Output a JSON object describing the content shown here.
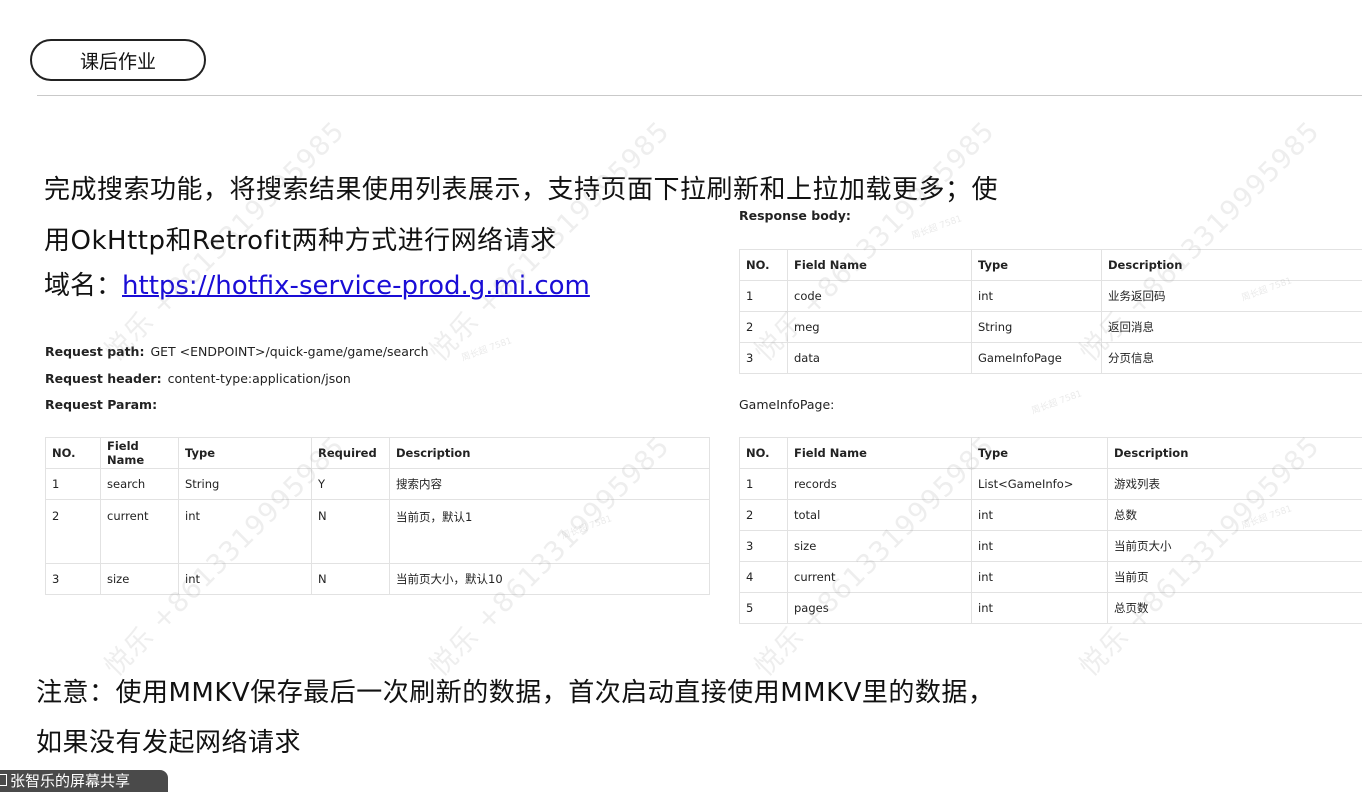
{
  "section_tag": "课后作业",
  "task": {
    "line1": "完成搜索功能，将搜索结果使用列表展示，支持页面下拉刷新和上拉加载更多；使",
    "line2": "用OkHttp和Retrofit两种方式进行网络请求",
    "domain_label": "域名：",
    "domain_url": "https://hotfix-service-prod.g.mi.com"
  },
  "request": {
    "path_label": "Request path:",
    "path_value": "GET <ENDPOINT>/quick-game/game/search",
    "header_label": "Request header:",
    "header_value": "content-type:application/json",
    "param_label": "Request Param:"
  },
  "request_params_table": {
    "headers": [
      "NO.",
      "Field Name",
      "Type",
      "Required",
      "Description"
    ],
    "rows": [
      [
        "1",
        "search",
        "String",
        "Y",
        "搜索内容"
      ],
      [
        "2",
        "current",
        "int",
        "N",
        "当前页，默认1"
      ],
      [
        "3",
        "size",
        "int",
        "N",
        "当前页大小，默认10"
      ]
    ]
  },
  "response_body": {
    "label": "Response body:",
    "headers": [
      "NO.",
      "Field Name",
      "Type",
      "Description"
    ],
    "rows": [
      [
        "1",
        "code",
        "int",
        "业务返回码"
      ],
      [
        "2",
        "meg",
        "String",
        "返回消息"
      ],
      [
        "3",
        "data",
        "GameInfoPage",
        "分页信息"
      ]
    ]
  },
  "game_info_page": {
    "label": "GameInfoPage:",
    "headers": [
      "NO.",
      "Field Name",
      "Type",
      "Description"
    ],
    "rows": [
      [
        "1",
        "records",
        "List<GameInfo>",
        "游戏列表"
      ],
      [
        "2",
        "total",
        "int",
        "总数"
      ],
      [
        "3",
        "size",
        "int",
        "当前页大小"
      ],
      [
        "4",
        "current",
        "int",
        "当前页"
      ],
      [
        "5",
        "pages",
        "int",
        "总页数"
      ]
    ]
  },
  "note": {
    "line1": "注意：使用MMKV保存最后一次刷新的数据，首次启动直接使用MMKV里的数据，",
    "line2": "如果没有发起网络请求"
  },
  "bottom_tag": "张智乐的屏幕共享",
  "watermark": {
    "large": "悦乐 +8613319995985",
    "small": "周长超 7581"
  }
}
